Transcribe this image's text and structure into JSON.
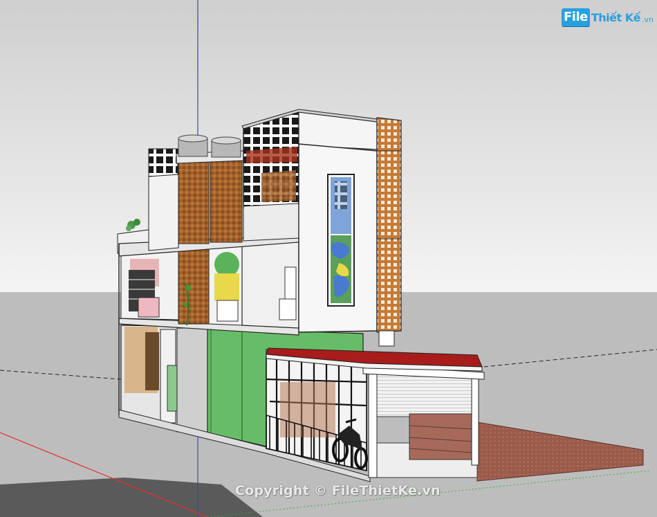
{
  "logo": {
    "file_text": "File",
    "brand_text": "Thiết Kế",
    "tld_text": ".vn"
  },
  "watermark": {
    "text": "Copyright © FileThietKe.vn"
  },
  "colors": {
    "sky": "#d8d8d8",
    "ground": "#bfbfbf",
    "axis_blue": "#2a2ae0",
    "axis_red": "#e02a2a",
    "axis_green": "#2ab02a",
    "wood": "#a0602a",
    "green_wall": "#6cbf6c",
    "roof_red": "#a81c1c",
    "brick": "#9a5a4a",
    "logo_blue": "#27a0e0"
  },
  "icons": {
    "camera": "perspective-view",
    "motorbike": "motorbike-icon",
    "plant": "plant-icon"
  }
}
